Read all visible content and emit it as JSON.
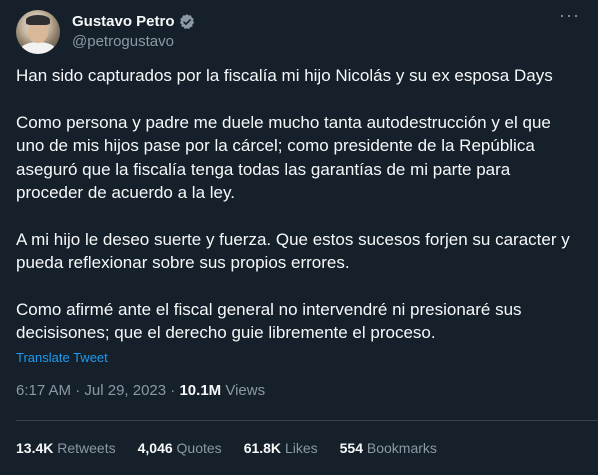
{
  "author": {
    "display_name": "Gustavo Petro",
    "handle": "@petrogustavo",
    "verified_icon": "verified-badge-icon",
    "verified_color": "#8b98a5"
  },
  "more_label": "···",
  "tweet": {
    "paragraphs": [
      "Han sido capturados por la fiscalía mi hijo Nicolás y su ex esposa Days",
      "Como persona y padre me duele mucho tanta autodestrucción y el que\nuno de mis hijos pase por la cárcel; como presidente de la República\naseguró  que la fiscalía tenga todas las garantías de mi parte para\nproceder de acuerdo a la ley.",
      "A mi hijo le deseo suerte y fuerza. Que estos sucesos forjen su caracter y\npueda reflexionar sobre sus propios errores.",
      "Como afirmé ante el fiscal general no intervendré ni presionaré sus\ndecisisones; que el derecho guie libremente el proceso."
    ],
    "translate_label": "Translate Tweet",
    "time": "6:17 AM",
    "separator": "·",
    "date": "Jul 29, 2023",
    "views_count": "10.1M",
    "views_label": "Views"
  },
  "stats": {
    "retweets": {
      "count": "13.4K",
      "label": "Retweets"
    },
    "quotes": {
      "count": "4,046",
      "label": "Quotes"
    },
    "likes": {
      "count": "61.8K",
      "label": "Likes"
    },
    "bookmarks": {
      "count": "554",
      "label": "Bookmarks"
    }
  },
  "colors": {
    "background": "#15202b",
    "text": "#f7f9f9",
    "secondary": "#8b98a5",
    "link": "#1d9bf0",
    "divider": "#38444d"
  }
}
